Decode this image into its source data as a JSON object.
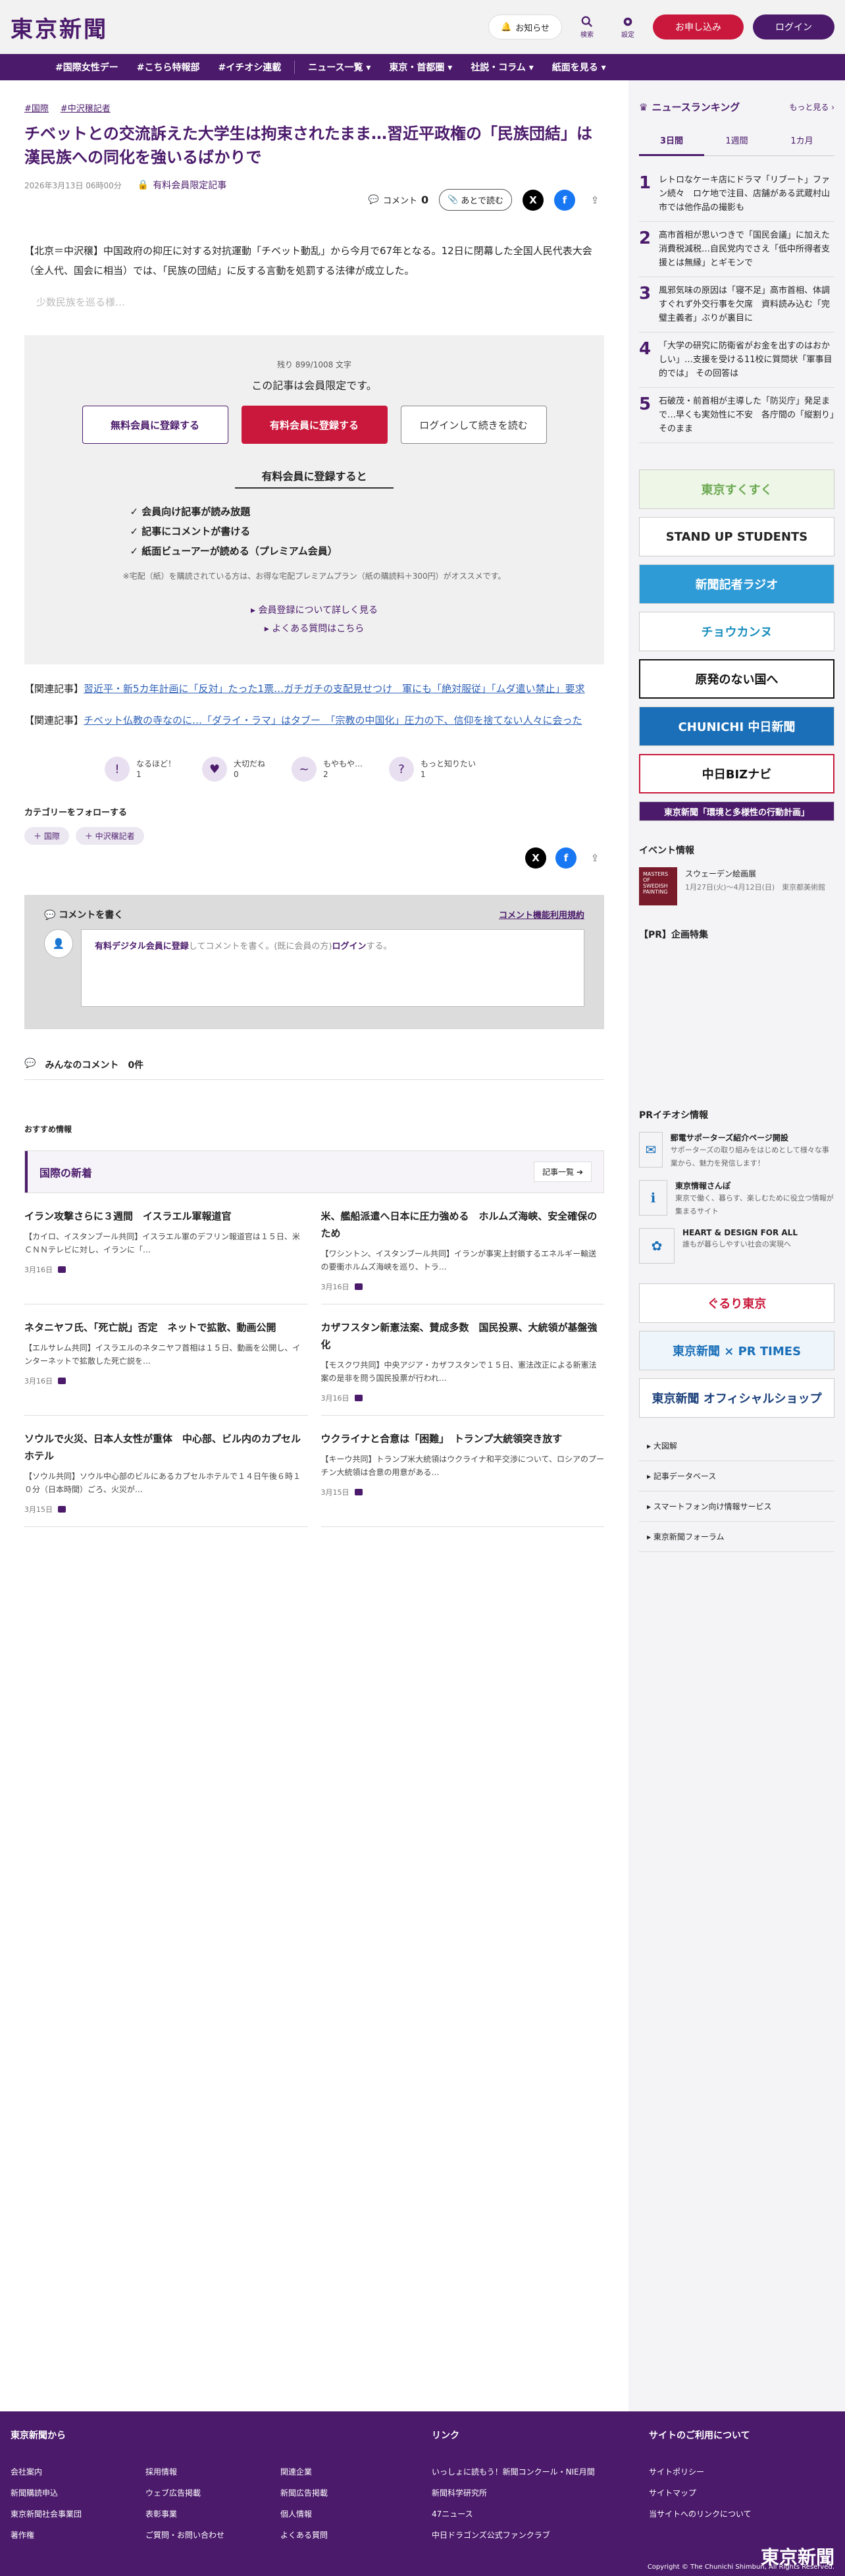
{
  "header": {
    "logo": "東京新聞",
    "notify_label": "お知らせ",
    "search_label": "検索",
    "settings_label": "設定",
    "signup_label": "お申し込み",
    "login_label": "ログイン"
  },
  "nav": {
    "items": [
      "#国際女性デー",
      "#こちら特報部",
      "#イチオシ連載",
      "ニュース一覧 ▾",
      "東京・首都圏 ▾",
      "社説・コラム ▾",
      "紙面を見る ▾"
    ]
  },
  "article": {
    "tags": [
      "#国際",
      "#中沢穣記者"
    ],
    "title": "チベットとの交流訴えた大学生は拘束されたまま…習近平政権の「民族団結」は漢民族への同化を強いるばかりで",
    "date": "2026年3月13日 06時00分",
    "members_label": "有料会員限定記事",
    "comment_label": "コメント",
    "comment_count": "0",
    "later_label": "あとで読む",
    "lead": "【北京＝中沢穣】中国政府の抑圧に対する対抗運動「チベット動乱」から今月で67年となる。12日に閉幕した全国人民代表大会（全人代、国会に相当）では、「民族の団結」に反する言動を処罰する法律が成立した。",
    "fade": "少数民族を巡る様…"
  },
  "paywall": {
    "remain": "残り 899/1008 文字",
    "title": "この記事は会員限定です。",
    "btn_free": "無料会員に登録する",
    "btn_paid": "有料会員に登録する",
    "btn_login": "ログインして続きを読む",
    "sub": "有料会員に登録すると",
    "benefits": [
      "✓ 会員向け記事が読み放題",
      "✓ 記事にコメントが書ける",
      "✓ 紙面ビューアーが読める（プレミアム会員）"
    ],
    "note": "※宅配（紙）を購読されている方は、お得な宅配プレミアムプラン（紙の購読料＋300円）がオススメです。",
    "link1": "▸ 会員登録について詳しく見る",
    "link2": "▸ よくある質問はこちら"
  },
  "related": [
    {
      "prefix": "【関連記事】",
      "text": "習近平・新5カ年計画に「反対」たった1票…ガチガチの支配見せつけ　軍にも「絶対服従」「ムダ遣い禁止」要求"
    },
    {
      "prefix": "【関連記事】",
      "text": "チベット仏教の寺なのに…「ダライ・ラマ」はタブー　「宗教の中国化」圧力の下、信仰を捨てない人々に会った"
    }
  ],
  "reactions": [
    {
      "label": "なるほど！",
      "count": "1",
      "icon": "!"
    },
    {
      "label": "大切だね",
      "count": "0",
      "icon": "♥"
    },
    {
      "label": "もやもや…",
      "count": "2",
      "icon": "~"
    },
    {
      "label": "もっと知りたい",
      "count": "1",
      "icon": "?"
    }
  ],
  "follow": {
    "title": "カテゴリーをフォローする",
    "tags": [
      "＋ 国際",
      "＋ 中沢穣記者"
    ]
  },
  "comments": {
    "write_title": "コメントを書く",
    "rules": "コメント機能利用規約",
    "box_link": "有料デジタル会員に登録",
    "box_mid": "してコメントを書く。(既に会員の方)",
    "box_login": "ログイン",
    "box_end": "する。",
    "all_title": "みんなのコメント",
    "all_count": "0件"
  },
  "recommend_title": "おすすめ情報",
  "intl": {
    "title": "国際の新着",
    "more": "記事一覧 ➔",
    "cards": [
      {
        "title": "イラン攻撃さらに３週間　イスラエル軍報道官",
        "body": "【カイロ、イスタンブール共同】イスラエル軍のデフリン報道官は１５日、米ＣＮＮテレビに対し、イランに「…",
        "date": "3月16日"
      },
      {
        "title": "米、艦船派遣へ日本に圧力強める　ホルムズ海峡、安全確保のため",
        "body": "【ワシントン、イスタンブール共同】イランが事実上封鎖するエネルギー輸送の要衝ホルムズ海峡を巡り、トラ…",
        "date": "3月16日"
      },
      {
        "title": "ネタニヤフ氏、「死亡説」否定　ネットで拡散、動画公開",
        "body": "【エルサレム共同】イスラエルのネタニヤフ首相は１５日、動画を公開し、インターネットで拡散した死亡説を…",
        "date": "3月16日"
      },
      {
        "title": "カザフスタン新憲法案、賛成多数　国民投票、大統領が基盤強化",
        "body": "【モスクワ共同】中央アジア・カザフスタンで１５日、憲法改正による新憲法案の是非を問う国民投票が行われ…",
        "date": "3月16日"
      },
      {
        "title": "ソウルで火災、日本人女性が重体　中心部、ビル内のカプセルホテル",
        "body": "【ソウル共同】ソウル中心部のビルにあるカプセルホテルで１４日午後６時１０分（日本時間）ごろ、火災が…",
        "date": "3月15日"
      },
      {
        "title": "ウクライナと合意は「困難」　トランプ大統領突き放す",
        "body": "【キーウ共同】トランプ米大統領はウクライナ和平交渉について、ロシアのプーチン大統領は合意の用意がある…",
        "date": "3月15日"
      }
    ]
  },
  "ranking": {
    "title": "ニュースランキング",
    "more": "もっと見る ›",
    "tabs": [
      "3日間",
      "1週間",
      "1カ月"
    ],
    "items": [
      {
        "no": "1",
        "text": "レトロなケーキ店にドラマ「リブート」ファン続々　ロケ地で注目、店舗がある武蔵村山市では他作品の撮影も"
      },
      {
        "no": "2",
        "text": "高市首相が思いつきで「国民会議」に加えた消費税減税…自民党内でさえ「低中所得者支援とは無縁」とギモンで"
      },
      {
        "no": "3",
        "text": "風邪気味の原因は「寝不足」高市首相、体調すぐれず外交行事を欠席　資料読み込む「完璧主義者」ぶりが裏目に"
      },
      {
        "no": "4",
        "text": "「大学の研究に防衛省がお金を出すのはおかしい」…支援を受ける11校に質問状「軍事目的では」 その回答は"
      },
      {
        "no": "5",
        "text": "石破茂・前首相が主導した「防災庁」発足まで…早くも実効性に不安　各庁間の「縦割り」そのまま"
      }
    ]
  },
  "banners": [
    {
      "label": "東京すくすく",
      "color": "#6aa84f"
    },
    {
      "label": "STAND UP STUDENTS",
      "color": "#222222"
    },
    {
      "label": "新聞記者ラジオ",
      "color": "#2f9bd6"
    },
    {
      "label": "チョウカンヌ",
      "color": "#1a8fbf"
    },
    {
      "label": "原発のない国へ",
      "color": "#111111"
    },
    {
      "label": "CHUNICHI 中日新聞",
      "color": "#1a6fb8"
    },
    {
      "label": "中日BIZナビ",
      "color": "#c9183b"
    },
    {
      "label": "東京新聞「環境と多様性の行動計画」",
      "color": "#4b1a6b"
    }
  ],
  "event": {
    "title": "イベント情報",
    "name": "スウェーデン絵画展",
    "info": "1月27日(火)〜4月12日(日)　東京都美術館",
    "thumb": "MASTERS OF SWEDISH PAINTING"
  },
  "pr_title": "【PR】企画特集",
  "pr_ichioshi": {
    "title": "PRイチオシ情報",
    "items": [
      {
        "name": "郵電サポーターズ紹介ページ開設",
        "desc": "サポーターズの取り組みをはじめとして様々な事業から、魅力を発信します！"
      },
      {
        "name": "東京情報さんぽ",
        "desc": "東京で働く、暮らす、楽しむために役立つ情報が集まるサイト"
      },
      {
        "name": "HEART & DESIGN FOR ALL",
        "desc": "誰もが暮らしやすい社会の実現へ"
      }
    ]
  },
  "side_banners": [
    "ぐるり東京",
    "東京新聞 × PR TIMES",
    "東京新聞 オフィシャルショップ"
  ],
  "side_links": [
    "大図解",
    "記事データベース",
    "スマートフォン向け情報サービス",
    "東京新聞フォーラム"
  ],
  "footer": {
    "col1_title": "東京新聞から",
    "col1_links": [
      "会社案内",
      "採用情報",
      "関連企業",
      "新聞購読申込",
      "ウェブ広告掲載",
      "新聞広告掲載",
      "東京新聞社会事業団",
      "表彰事業",
      "個人情報",
      "著作権",
      "ご質問・お問い合わせ",
      "よくある質問"
    ],
    "col2_title": "リンク",
    "col2_links": [
      "いっしょに読もう！新聞コンクール・NIE月間",
      "新聞科学研究所",
      "47ニュース",
      "中日ドラゴンズ公式ファンクラブ"
    ],
    "col3_title": "サイトのご利用について",
    "col3_links": [
      "サイトポリシー",
      "サイトマップ",
      "当サイトへのリンクについて"
    ],
    "logo": "東京新聞",
    "copyright": "Copyright © The Chunichi Shimbun, All Rights Reserved."
  }
}
